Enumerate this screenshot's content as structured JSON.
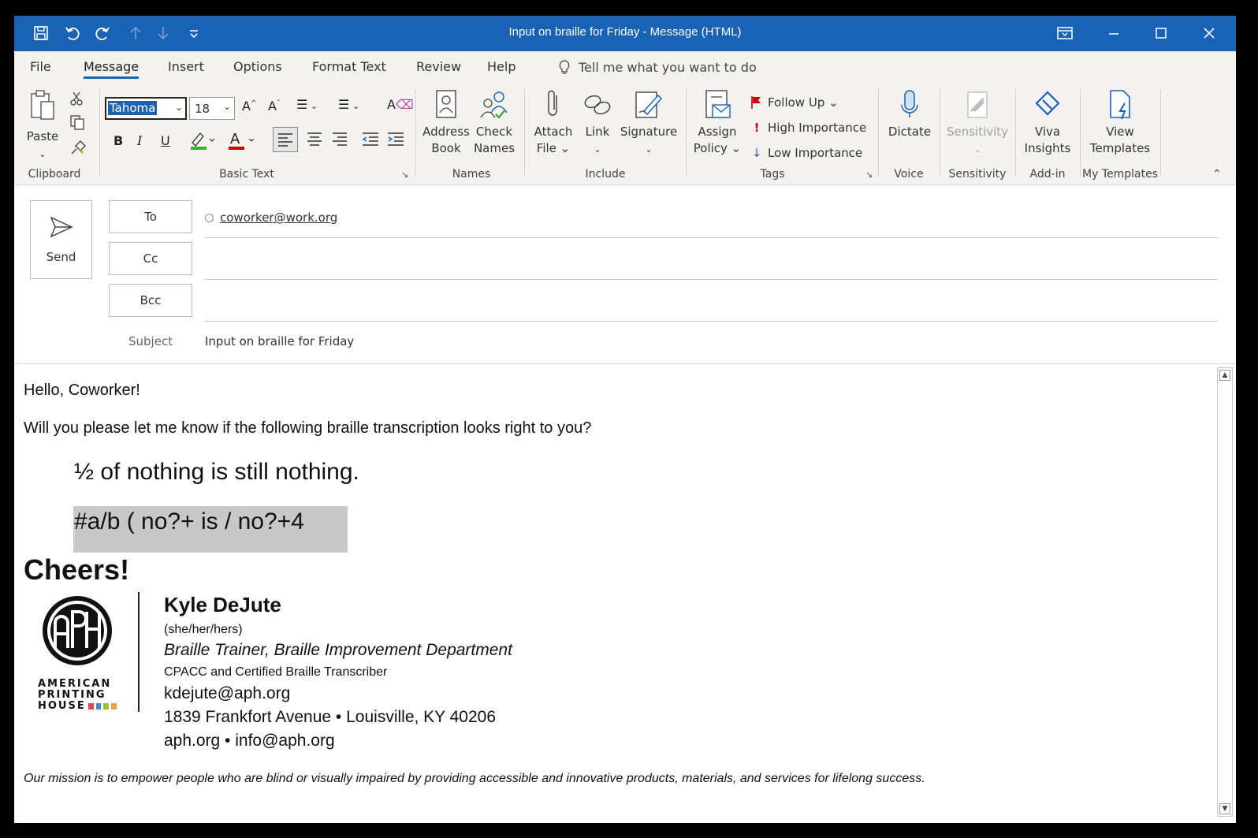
{
  "titlebar": {
    "title": "Input on braille for Friday  -  Message (HTML)",
    "accent": "#1a62b5"
  },
  "menu": {
    "tabs": [
      "File",
      "Message",
      "Insert",
      "Options",
      "Format Text",
      "Review",
      "Help"
    ],
    "active": "Message",
    "tell_me": "Tell me what you want to do"
  },
  "ribbon": {
    "clipboard": {
      "paste": "Paste",
      "label": "Clipboard"
    },
    "basic_text": {
      "font": "Tahoma",
      "size": "18",
      "bold": "B",
      "italic": "I",
      "underline": "U",
      "label": "Basic Text"
    },
    "names": {
      "address_book_1": "Address",
      "address_book_2": "Book",
      "check_names_1": "Check",
      "check_names_2": "Names",
      "label": "Names"
    },
    "include": {
      "attach_1": "Attach",
      "attach_2": "File ⌄",
      "link": "Link",
      "signature": "Signature",
      "label": "Include"
    },
    "tags": {
      "assign_1": "Assign",
      "assign_2": "Policy ⌄",
      "follow_up": "Follow Up ⌄",
      "high": "High Importance",
      "low": "Low Importance",
      "label": "Tags"
    },
    "voice": {
      "dictate": "Dictate",
      "label": "Voice"
    },
    "sensitivity": {
      "button": "Sensitivity",
      "label": "Sensitivity"
    },
    "addin": {
      "viva_1": "Viva",
      "viva_2": "Insights",
      "label": "Add-in"
    },
    "templates": {
      "view_1": "View",
      "view_2": "Templates",
      "label": "My Templates"
    }
  },
  "compose": {
    "send": "Send",
    "to_label": "To",
    "cc_label": "Cc",
    "bcc_label": "Bcc",
    "to_value": "coworker@work.org",
    "subject_label": "Subject",
    "subject_value": "Input on braille for Friday"
  },
  "body": {
    "greeting": "Hello, Coworker!",
    "request": "Will you please let me know if the following braille transcription looks right to you?",
    "print_line": "½ of nothing is still nothing.",
    "braille_line": "#a/b ( no?+ is / no?+4",
    "closing": "Cheers!",
    "signature": {
      "logo_line1": "AMERICAN",
      "logo_line2": "PRINTING",
      "logo_line3": "HOUSE",
      "name": "Kyle DeJute",
      "pronouns": "(she/her/hers)",
      "title": "Braille Trainer, Braille Improvement Department",
      "cert": "CPACC and Certified Braille Transcriber",
      "email": "kdejute@aph.org",
      "address": "1839 Frankfort Avenue • Louisville, KY 40206",
      "web": "aph.org • info@aph.org"
    },
    "mission": "Our mission is to empower people who are blind or visually impaired by providing accessible and innovative products, materials, and services for lifelong success."
  }
}
